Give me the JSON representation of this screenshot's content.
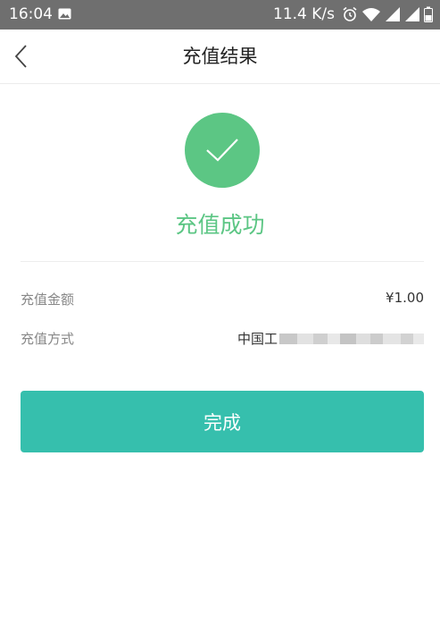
{
  "status_bar": {
    "time": "16:04",
    "network_speed": "11.4 K/s",
    "icons": [
      "image-icon",
      "alarm-icon",
      "wifi-icon",
      "signal-icon",
      "signal-icon",
      "battery-icon"
    ]
  },
  "nav": {
    "title": "充值结果",
    "back_icon": "chevron-left-icon"
  },
  "result": {
    "icon": "check-icon",
    "message": "充值成功",
    "accent_color": "#5cc684"
  },
  "details": {
    "amount_label": "充值金额",
    "amount_value": "¥1.00",
    "method_label": "充值方式",
    "method_value_visible": "中国工"
  },
  "actions": {
    "done_label": "完成",
    "button_color": "#36bfad"
  }
}
